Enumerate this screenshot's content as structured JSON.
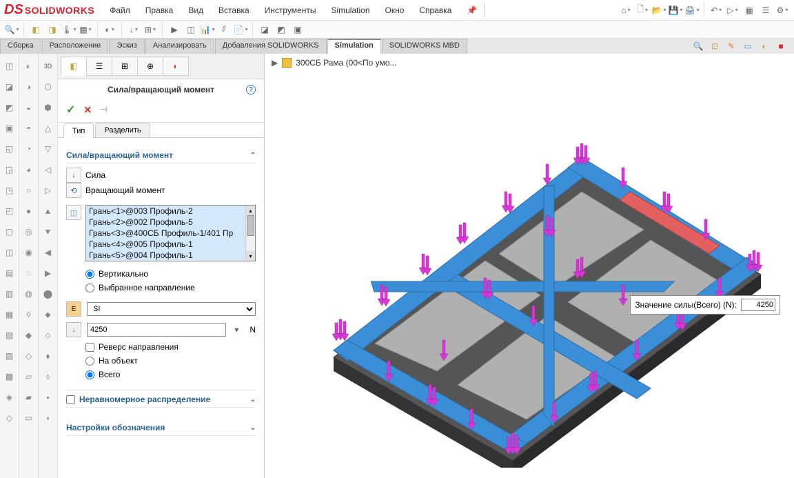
{
  "app": {
    "name": "SOLIDWORKS"
  },
  "menu": [
    "Файл",
    "Правка",
    "Вид",
    "Вставка",
    "Инструменты",
    "Simulation",
    "Окно",
    "Справка"
  ],
  "tabs": [
    "Сборка",
    "Расположение",
    "Эскиз",
    "Анализировать",
    "Добавления SOLIDWORKS",
    "Simulation",
    "SOLIDWORKS MBD"
  ],
  "active_tab": "Simulation",
  "breadcrumb": {
    "label": "300СБ Рама  (00<По умо..."
  },
  "panel": {
    "title": "Сила/вращающий момент",
    "sub_tabs": {
      "type": "Тип",
      "split": "Разделить"
    },
    "section_force": {
      "head": "Сила/вращающий момент",
      "force": "Сила",
      "torque": "Вращающий момент"
    },
    "faces": [
      "Грань<1>@003 Профиль-2",
      "Грань<2>@002 Профиль-5",
      "Грань<3>@400СБ Профиль-1/401 Пр",
      "Грань<4>@005 Профиль-1",
      "Грань<5>@004 Профиль-1"
    ],
    "direction": {
      "vertical": "Вертикально",
      "selected": "Выбранное направление"
    },
    "units": {
      "value": "SI",
      "options": [
        "SI"
      ]
    },
    "force_value": "4250",
    "unit_label": "N",
    "reverse": "Реверс направления",
    "per_item": {
      "object": "На объект",
      "total": "Всего"
    },
    "nonuniform": "Неравномерное распределение",
    "annotation_settings": "Настройки обозначения"
  },
  "tooltip": {
    "label": "Значение силы(Всего) (N):",
    "value": "4250"
  }
}
